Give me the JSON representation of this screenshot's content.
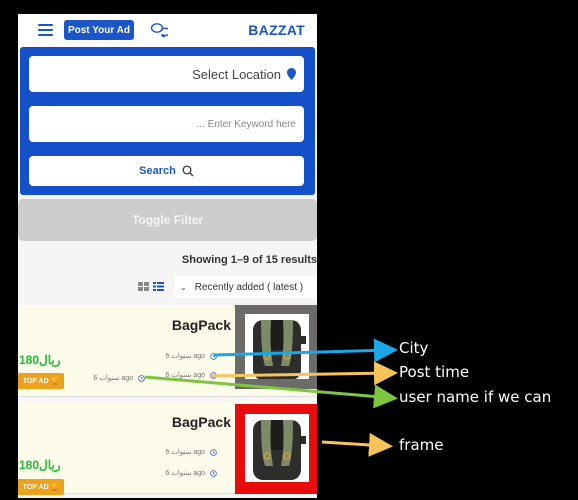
{
  "header": {
    "post_ad_label": "Post Your Ad",
    "brand": "BAZZAT",
    "menu_icon": "hamburger-icon",
    "chat_icon": "chat-bubbles-icon"
  },
  "search": {
    "location_placeholder": "Select Location",
    "keyword_placeholder": "... Enter Keyword here",
    "button_label": "Search",
    "location_icon": "map-pin-icon",
    "search_icon": "magnifier-icon"
  },
  "filters": {
    "toggle_label": "Toggle Filter",
    "results_text": "Showing 1–9 of 15 results",
    "sort_selected": "Recently added ( latest )",
    "view_modes": [
      "grid",
      "list"
    ],
    "active_view": "list"
  },
  "listings": [
    {
      "title": "BagPack",
      "city": "6 سنوات ago",
      "post_time": "6 سنوات ago",
      "user": "6 سنوات ago",
      "price": "180ريال",
      "badge": "TOP AD",
      "frame_color": "#6d6a6a"
    },
    {
      "title": "BagPack",
      "city": "6 سنوات ago",
      "post_time": "6 سنوات ago",
      "price": "180ريال",
      "badge": "TOP AD",
      "frame_color": "#e80c0c"
    }
  ],
  "annotations": {
    "city": "City",
    "post_time": "Post time",
    "user_name": "user name if we can",
    "frame": "frame"
  },
  "colors": {
    "primary": "#1a56c8",
    "price": "#22bb33",
    "badge": "#eea21b",
    "arrow_blue": "#19a7e6",
    "arrow_yellow": "#f7c45b",
    "arrow_green": "#7ec540"
  }
}
